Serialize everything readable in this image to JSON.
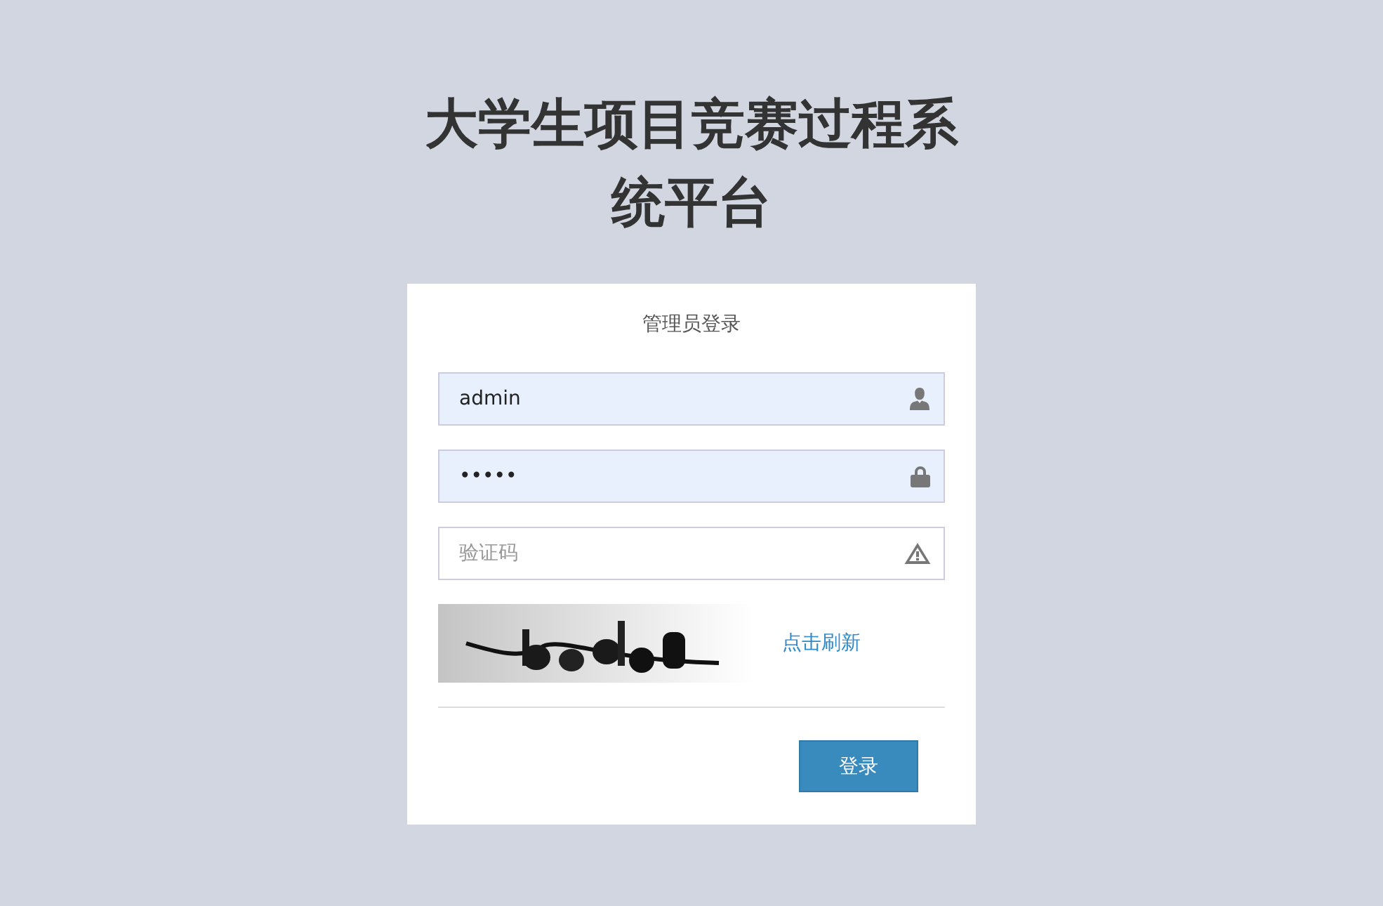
{
  "title": "大学生项目竞赛过程系统平台",
  "login": {
    "heading": "管理员登录",
    "fields": [
      {
        "kind": "user",
        "value": "admin",
        "autofilled": true
      },
      {
        "kind": "lock",
        "value": "•••••",
        "autofilled": true
      },
      {
        "kind": "warning",
        "placeholder": "验证码",
        "autofilled": false
      }
    ],
    "captcha": {
      "kind": "picture",
      "refresh_link": "点击刷新"
    },
    "submit": "登录"
  }
}
